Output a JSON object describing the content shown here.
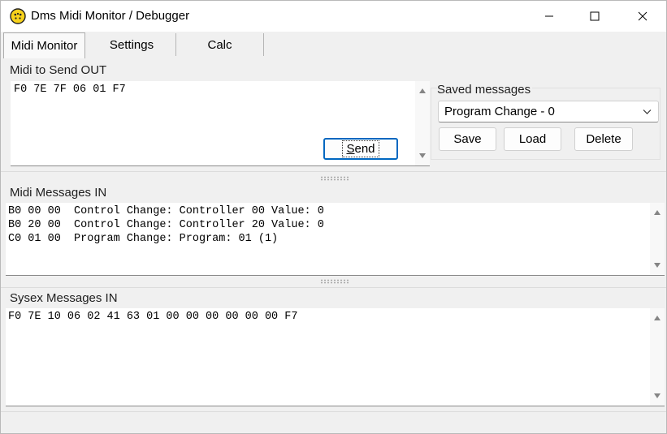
{
  "window": {
    "title": "Dms Midi Monitor / Debugger"
  },
  "tabs": [
    {
      "label": "Midi Monitor",
      "active": true
    },
    {
      "label": "Settings",
      "active": false
    },
    {
      "label": "Calc",
      "active": false
    }
  ],
  "send_out": {
    "label": "Midi to Send OUT",
    "value": "F0 7E 7F 06 01 F7",
    "send_label": "Send"
  },
  "saved": {
    "label": "Saved messages",
    "selected": "Program Change - 0",
    "save_label": "Save",
    "load_label": "Load",
    "delete_label": "Delete"
  },
  "midi_in": {
    "label": "Midi Messages IN",
    "lines": [
      "B0 00 00  Control Change: Controller 00 Value: 0",
      "B0 20 00  Control Change: Controller 20 Value: 0",
      "C0 01 00  Program Change: Program: 01 (1)"
    ]
  },
  "sysex_in": {
    "label": "Sysex Messages IN",
    "lines": [
      "F0 7E 10 06 02 41 63 01 00 00 00 00 00 00 F7"
    ]
  },
  "icons": {
    "app": "smiley-app-icon",
    "minimize": "minimize-icon",
    "maximize": "maximize-icon",
    "close": "close-icon"
  },
  "colors": {
    "default_button_border": "#0067c0",
    "window_bg": "#f0f0f0",
    "textbox_bg": "#ffffff"
  }
}
